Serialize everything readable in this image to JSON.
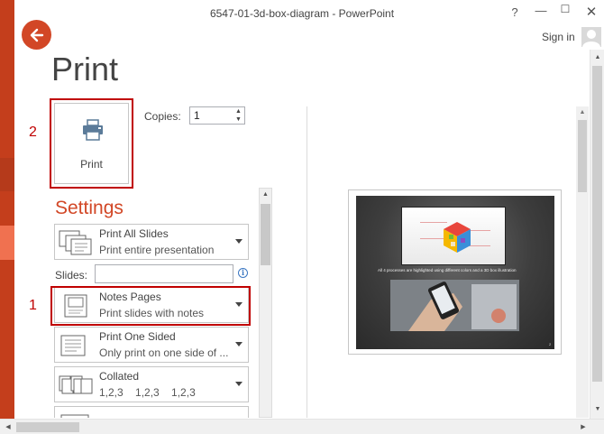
{
  "window": {
    "title": "6547-01-3d-box-diagram - PowerPoint",
    "help_glyph": "?",
    "minimize_glyph": "—",
    "maximize_glyph": "☐",
    "close_glyph": "✕",
    "sign_in": "Sign in"
  },
  "page": {
    "title": "Print"
  },
  "annotations": {
    "step1": "1",
    "step2": "2"
  },
  "print_button": {
    "label": "Print"
  },
  "copies": {
    "label": "Copies:",
    "value": "1",
    "up": "▲",
    "down": "▼"
  },
  "settings": {
    "title": "Settings",
    "slides_label": "Slides:",
    "slides_value": "",
    "info_glyph": "i",
    "dropdowns": [
      {
        "main": "Print All Slides",
        "sub": "Print entire presentation",
        "icon": "all-slides-icon"
      },
      {
        "main": "Notes Pages",
        "sub": "Print slides with notes",
        "icon": "notes-pages-icon"
      },
      {
        "main": "Print One Sided",
        "sub": "Only print on one side of ...",
        "icon": "one-sided-icon"
      },
      {
        "main": "Collated",
        "sub": "1,2,3    1,2,3    1,2,3",
        "icon": "collated-icon"
      }
    ]
  },
  "preview": {
    "slide_caption": "All 4 processes are highlighted using different colors and a 3D box illustration",
    "page_number": "2"
  },
  "scroll": {
    "up": "▲",
    "down": "▼",
    "left": "◀",
    "right": "▶"
  },
  "colors": {
    "accent": "#d24726",
    "highlight": "#c00000",
    "strip": "#c43e1c"
  }
}
